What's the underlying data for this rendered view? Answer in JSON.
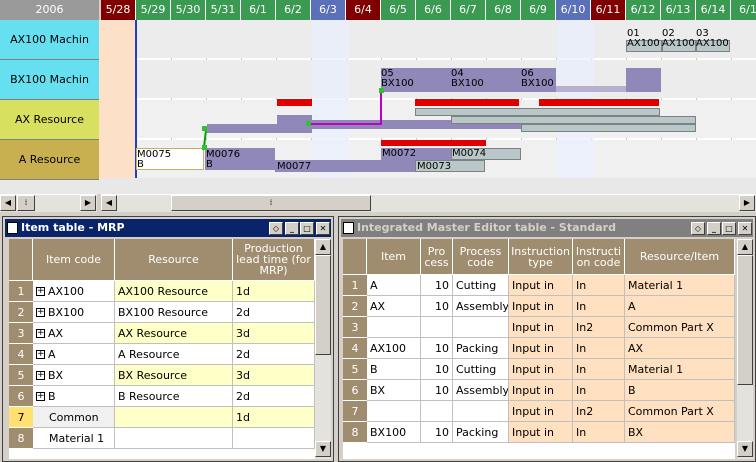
{
  "gantt": {
    "year": "2006",
    "dates": [
      {
        "label": "5/28",
        "color": "#800000"
      },
      {
        "label": "5/29",
        "color": "#3a9a52"
      },
      {
        "label": "5/30",
        "color": "#3a9a52"
      },
      {
        "label": "5/31",
        "color": "#3a9a52"
      },
      {
        "label": "6/1",
        "color": "#3a9a52"
      },
      {
        "label": "6/2",
        "color": "#3a9a52"
      },
      {
        "label": "6/3",
        "color": "#5a70b8"
      },
      {
        "label": "6/4",
        "color": "#800000"
      },
      {
        "label": "6/5",
        "color": "#3a9a52"
      },
      {
        "label": "6/6",
        "color": "#3a9a52"
      },
      {
        "label": "6/7",
        "color": "#3a9a52"
      },
      {
        "label": "6/8",
        "color": "#3a9a52"
      },
      {
        "label": "6/9",
        "color": "#3a9a52"
      },
      {
        "label": "6/10",
        "color": "#5a70b8"
      },
      {
        "label": "6/11",
        "color": "#800000"
      },
      {
        "label": "6/12",
        "color": "#3a9a52"
      },
      {
        "label": "6/13",
        "color": "#3a9a52"
      },
      {
        "label": "6/14",
        "color": "#3a9a52"
      },
      {
        "label": "6/1",
        "color": "#3a9a52"
      }
    ],
    "rows": [
      {
        "label": "AX100 Machin",
        "color": "#66e0f0"
      },
      {
        "label": "BX100 Machin",
        "color": "#66e0f0"
      },
      {
        "label": "AX Resource",
        "color": "#d8e060"
      },
      {
        "label": "A Resource",
        "color": "#c8b050"
      }
    ],
    "bar_labels": {
      "ax01": "01\nAX100",
      "ax02": "02\nAX100",
      "ax03": "03\nAX100",
      "bx05": "05\nBX100",
      "bx04": "04\nBX100",
      "bx06": "06\nBX100",
      "m0075": "M0075\nB",
      "m0076": "M0076\nB",
      "m0077": "M0077",
      "m0072": "M0072",
      "m0074": "M0074",
      "m0073": "M0073"
    }
  },
  "item_table": {
    "title": "Item table - MRP",
    "headers": [
      "Item code",
      "Resource",
      "Production lead time (for MRP)"
    ],
    "rows": [
      {
        "n": "1",
        "code": "AX100",
        "resource": "AX100 Resource",
        "lead": "1d",
        "expand": true
      },
      {
        "n": "2",
        "code": "BX100",
        "resource": "BX100 Resource",
        "lead": "2d",
        "expand": true
      },
      {
        "n": "3",
        "code": "AX",
        "resource": "AX Resource",
        "lead": "3d",
        "expand": true
      },
      {
        "n": "4",
        "code": "A",
        "resource": "A Resource",
        "lead": "2d",
        "expand": true
      },
      {
        "n": "5",
        "code": "BX",
        "resource": "BX Resource",
        "lead": "3d",
        "expand": true
      },
      {
        "n": "6",
        "code": "B",
        "resource": "B Resource",
        "lead": "2d",
        "expand": true
      },
      {
        "n": "7",
        "code": "Common",
        "resource": "",
        "lead": "1d",
        "expand": false
      },
      {
        "n": "8",
        "code": "Material 1",
        "resource": "",
        "lead": "",
        "expand": false
      }
    ]
  },
  "master_table": {
    "title": "Integrated Master Editor table - Standard",
    "headers": [
      "Item",
      "Pro cess",
      "Process code",
      "Instruction type",
      "Instructi on code",
      "Resource/Item"
    ],
    "rows": [
      {
        "n": "1",
        "item": "A",
        "proc": "10",
        "pcode": "Cutting",
        "itype": "Input in",
        "icode": "In",
        "res": "Material 1"
      },
      {
        "n": "2",
        "item": "AX",
        "proc": "10",
        "pcode": "Assembly",
        "itype": "Input in",
        "icode": "In",
        "res": "A"
      },
      {
        "n": "3",
        "item": "",
        "proc": "",
        "pcode": "",
        "itype": "Input in",
        "icode": "In2",
        "res": "Common Part X"
      },
      {
        "n": "4",
        "item": "AX100",
        "proc": "10",
        "pcode": "Packing",
        "itype": "Input in",
        "icode": "In",
        "res": "AX"
      },
      {
        "n": "5",
        "item": "B",
        "proc": "10",
        "pcode": "Cutting",
        "itype": "Input in",
        "icode": "In",
        "res": "Material 1"
      },
      {
        "n": "6",
        "item": "BX",
        "proc": "10",
        "pcode": "Assembly",
        "itype": "Input in",
        "icode": "In",
        "res": "B"
      },
      {
        "n": "7",
        "item": "",
        "proc": "",
        "pcode": "",
        "itype": "Input in",
        "icode": "In2",
        "res": "Common Part X"
      },
      {
        "n": "8",
        "item": "BX100",
        "proc": "10",
        "pcode": "Packing",
        "itype": "Input in",
        "icode": "In",
        "res": "BX"
      }
    ]
  },
  "colors": {
    "title_active": "#0a246a",
    "title_inactive": "#808080",
    "header": "#a08c6e",
    "yellow_row": "#ffffc8",
    "peach": "#ffe0c0"
  }
}
